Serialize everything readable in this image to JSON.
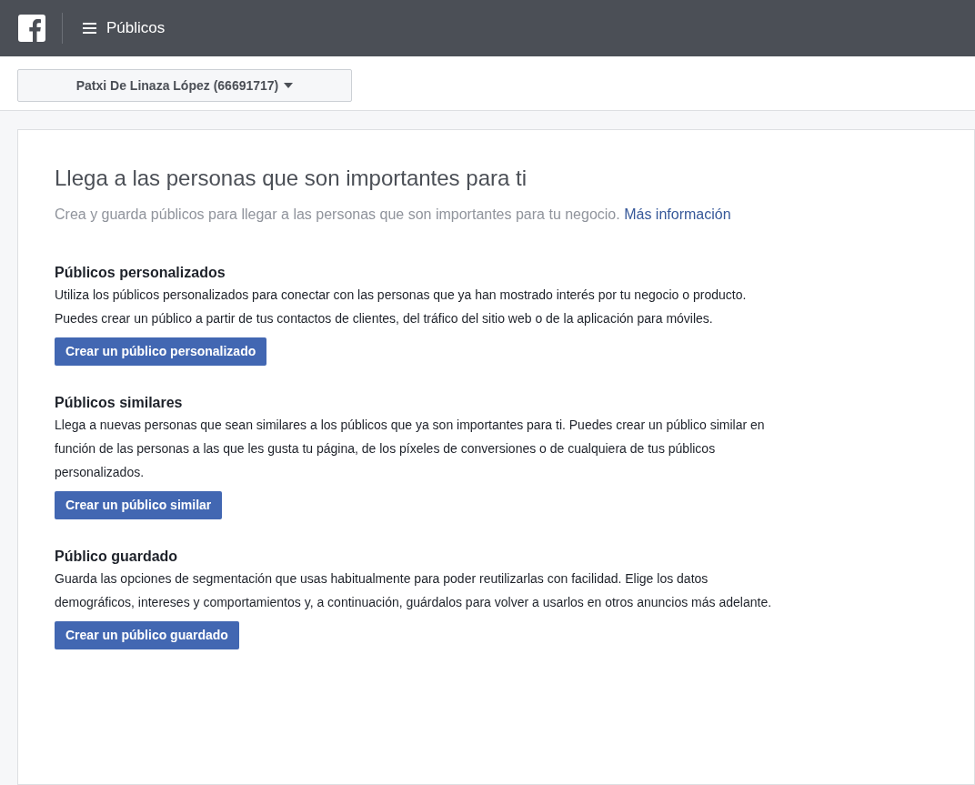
{
  "top_bar": {
    "title": "Públicos"
  },
  "account_selector": {
    "label": "Patxi De Linaza López (66691717)"
  },
  "intro": {
    "heading": "Llega a las personas que son importantes para ti",
    "text": "Crea y guarda públicos para llegar a las personas que son importantes para tu negocio.",
    "link": "Más información"
  },
  "sections": [
    {
      "title": "Públicos personalizados",
      "text": "Utiliza los públicos personalizados para conectar con las personas que ya han mostrado interés por tu negocio o producto. Puedes crear un público a partir de tus contactos de clientes, del tráfico del sitio web o de la aplicación para móviles.",
      "button": "Crear un público personalizado"
    },
    {
      "title": "Públicos similares",
      "text": "Llega a nuevas personas que sean similares a los públicos que ya son importantes para ti. Puedes crear un público similar en función de las personas a las que les gusta tu página, de los píxeles de conversiones o de cualquiera de tus públicos personalizados.",
      "button": "Crear un público similar"
    },
    {
      "title": "Público guardado",
      "text": "Guarda las opciones de segmentación que usas habitualmente para poder reutilizarlas con facilidad. Elige los datos demográficos, intereses y comportamientos y, a continuación, guárdalos para volver a usarlos en otros anuncios más adelante.",
      "button": "Crear un público guardado"
    }
  ]
}
